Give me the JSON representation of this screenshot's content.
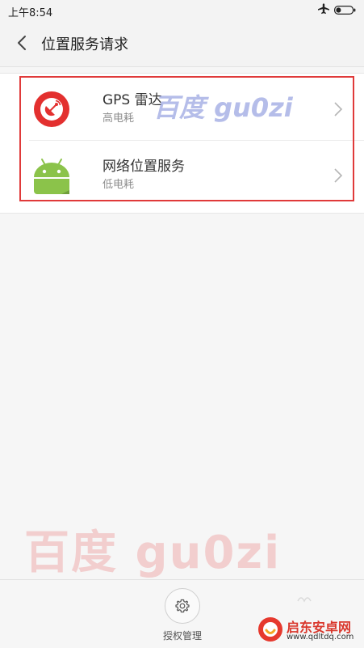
{
  "status_bar": {
    "time": "上午8:54",
    "icons": [
      "airplane-icon",
      "battery-icon"
    ]
  },
  "header": {
    "title": "位置服务请求",
    "back_icon": "chevron-left-icon"
  },
  "items": [
    {
      "title": "GPS 雷达",
      "subtitle": "高电耗",
      "icon": "gps-radar-icon",
      "icon_color": "#e3302f"
    },
    {
      "title": "网络位置服务",
      "subtitle": "低电耗",
      "icon": "android-icon",
      "icon_color": "#8bc34a"
    }
  ],
  "highlight": {
    "color": "#e03a3a"
  },
  "watermarks": {
    "top": "百度 gu0zi",
    "bottom": "百度  gu0zi"
  },
  "bottom_bar": {
    "auth_label": "授权管理",
    "auth_icon": "gear-icon"
  },
  "brand": {
    "name": "启东安卓网",
    "url": "www.qdltdq.com",
    "logo_color": "#e6392e"
  }
}
